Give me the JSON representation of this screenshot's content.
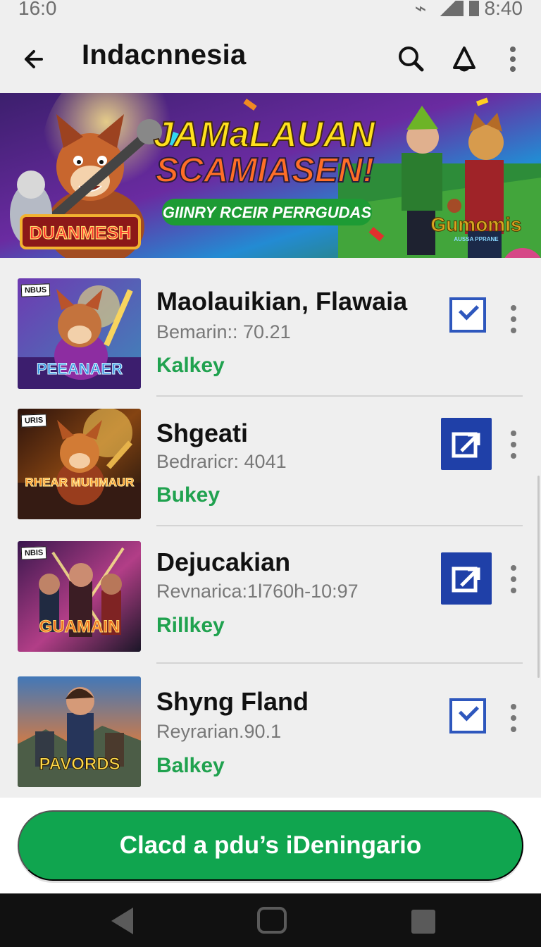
{
  "status": {
    "time": "16:0",
    "right": "8:40"
  },
  "app_bar": {
    "title": "Indacnnesia"
  },
  "banner": {
    "left_badge": "DUANMESH",
    "headline_1": "JAMaLAUAN",
    "headline_2": "SCAMIASEN!",
    "subtitle": "GIINRY RCEIR PERRGUDAS",
    "right_logo": "Gumomis",
    "right_logo_sub": "AUSSA PPRANE"
  },
  "items": [
    {
      "tag": "NBUS",
      "name": "Maolauikian, Flawaia",
      "meta": "Bemarin:: 70.21",
      "status": "Kalkey",
      "art": "PEEANAER",
      "action": "checkbox"
    },
    {
      "tag": "URIS",
      "name": "Shgeati",
      "meta": "Bedraricr: 4041",
      "status": "Bukey",
      "art": "RHEAR MUHMAUR",
      "action": "share"
    },
    {
      "tag": "NBIS",
      "name": "Dejucakian",
      "meta": "Revnarica:1l760h-10:97",
      "status": "Rillkey",
      "art": "GUAMAIN",
      "action": "share"
    },
    {
      "tag": "",
      "name": "Shyng Fland",
      "meta": "Reyrarian.90.1",
      "status": "Balkey",
      "art": "PAVORDS",
      "action": "checkbox"
    }
  ],
  "bottom_button": {
    "label": "Clacd a pdu’s iDeningario"
  },
  "colors": {
    "primary_green": "#10a54f",
    "status_green": "#20a24f",
    "action_blue": "#1f40a8"
  }
}
